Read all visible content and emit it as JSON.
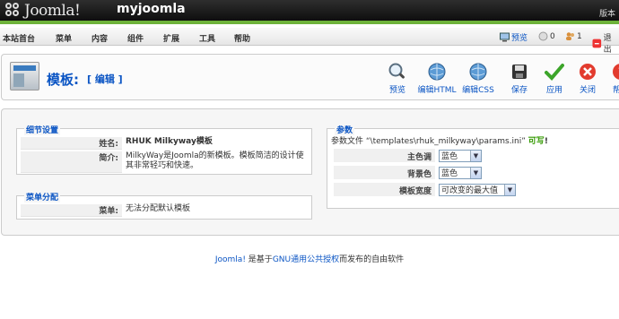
{
  "header": {
    "logo_text": "Joomla!",
    "site_name": "myjoomla",
    "version_label": "版本"
  },
  "menubar": {
    "items": [
      "本站首台",
      "菜单",
      "内容",
      "组件",
      "扩展",
      "工具",
      "帮助"
    ],
    "preview": "预览",
    "messages_count": "0",
    "users_count": "1",
    "logout": "退出"
  },
  "toolbar": {
    "title": "模板:",
    "subtitle": "[ 编辑 ]",
    "buttons": {
      "preview": "预览",
      "edit_html": "编辑HTML",
      "edit_css": "编辑CSS",
      "save": "保存",
      "apply": "应用",
      "close": "关闭",
      "help": "帮助"
    }
  },
  "details": {
    "legend": "细节设置",
    "name_key": "姓名:",
    "name_value": "RHUK Milkyway模板",
    "desc_key": "简介:",
    "desc_value": "MilkyWay是Joomla的新模板。模板简洁的设计使其非常轻巧和快速。"
  },
  "menu_assign": {
    "legend": "菜单分配",
    "menu_key": "菜单:",
    "menu_value": "无法分配默认模板"
  },
  "params": {
    "legend": "参数",
    "file_prefix": "参数文件 “",
    "file_path": "\\templates\\rhuk_milkyway\\params.ini",
    "file_suffix": "” ",
    "writable": "可写",
    "writable_mark": "!",
    "color_key": "主色调",
    "color_value": "蓝色",
    "bg_key": "背景色",
    "bg_value": "蓝色",
    "width_key": "模板宽度",
    "width_value": "可改变的最大值"
  },
  "footer": {
    "link": "Joomla!",
    "text1": " 是基于",
    "license": "GNU通用公共授权",
    "text2": "而发布的自由软件"
  },
  "colors": {
    "accent_blue": "#0b55c4",
    "header_green": "#6eb33a",
    "writable_green": "#339900"
  }
}
